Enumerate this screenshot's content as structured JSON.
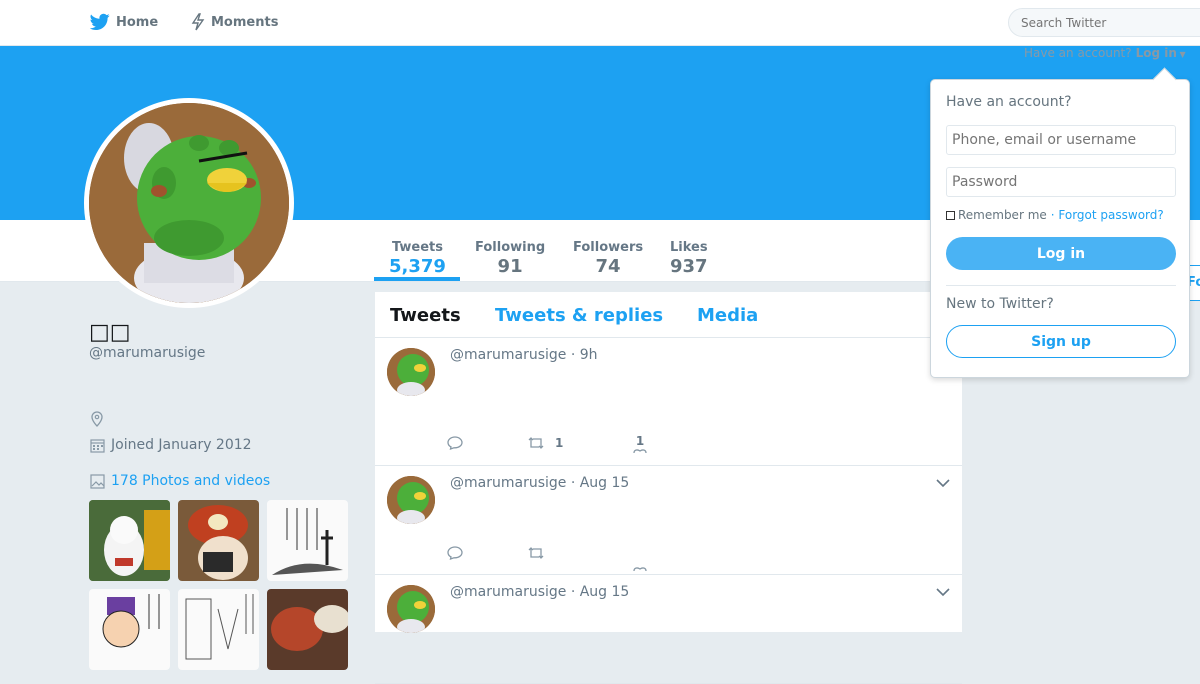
{
  "nav": {
    "home_label": "Home",
    "moments_label": "Moments",
    "search_placeholder": "Search Twitter"
  },
  "account_link": {
    "prompt": "Have an account?",
    "login_label": "Log in"
  },
  "profile": {
    "name": "□□",
    "handle": "@marumarusige",
    "joined": "Joined January 2012",
    "photos_label": "178 Photos and videos"
  },
  "stats": [
    {
      "label": "Tweets",
      "value": "5,379"
    },
    {
      "label": "Following",
      "value": "91"
    },
    {
      "label": "Followers",
      "value": "74"
    },
    {
      "label": "Likes",
      "value": "937"
    }
  ],
  "timeline": {
    "tabs": [
      "Tweets",
      "Tweets & replies",
      "Media"
    ],
    "tweets": [
      {
        "handle": "@marumarusige",
        "time": "9h",
        "retweets": "1",
        "likes": "1"
      },
      {
        "handle": "@marumarusige",
        "time": "Aug 15",
        "retweets": "",
        "likes": ""
      },
      {
        "handle": "@marumarusige",
        "time": "Aug 15",
        "retweets": "",
        "likes": ""
      }
    ]
  },
  "login": {
    "title": "Have an account?",
    "username_placeholder": "Phone, email or username",
    "password_placeholder": "Password",
    "remember": "Remember me",
    "forgot": "· Forgot password?",
    "login_button": "Log in",
    "new_prompt": "New to Twitter?",
    "signup_button": "Sign up"
  },
  "follow_peek": "Fo",
  "colors": {
    "brand": "#1da1f2",
    "banner": "#1da1f2"
  }
}
